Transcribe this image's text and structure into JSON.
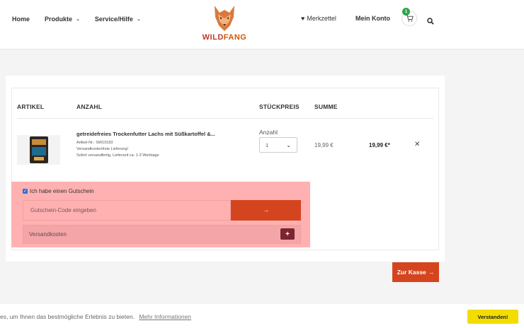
{
  "nav": {
    "items": [
      {
        "label": "Home",
        "has_dropdown": false
      },
      {
        "label": "Produkte",
        "has_dropdown": true
      },
      {
        "label": "Service/Hilfe",
        "has_dropdown": true
      }
    ]
  },
  "logo": {
    "text_part1": "WILD",
    "text_part2": "FANG"
  },
  "header": {
    "wishlist_label": "Merkzettel",
    "account_label": "Mein Konto",
    "cart_count": "1"
  },
  "table": {
    "col_article": "ARTIKEL",
    "col_quantity": "ANZAHL",
    "col_unit_price": "STÜCKPREIS",
    "col_total": "SUMME"
  },
  "product": {
    "title": "getreidefreies Trockenfutter Lachs mit Süßkartoffel &...",
    "article_no": "Artikel-Nr.: SW10183",
    "shipping_free": "Versandkostenfreie Lieferung!",
    "delivery": "Sofort versandfertig, Lieferzeit ca. 1-3 Werktage",
    "quantity_label": "Anzahl",
    "quantity_value": "1",
    "unit_price": "19,99 €",
    "line_total": "19,99 €*"
  },
  "voucher": {
    "checkbox_label": "Ich habe einen Gutschein",
    "input_placeholder": "Gutschein-Code eingeben",
    "shipping_label": "Versandkosten"
  },
  "checkout": {
    "label": "Zur Kasse"
  },
  "cookie": {
    "text": "es, um Ihnen das bestmögliche Erlebnis zu bieten.",
    "link": "Mehr Informationen",
    "button": "Verstanden!"
  },
  "colors": {
    "accent": "#d4451f",
    "highlight": "#ffb1b1",
    "cookie_button": "#f3dd00"
  }
}
